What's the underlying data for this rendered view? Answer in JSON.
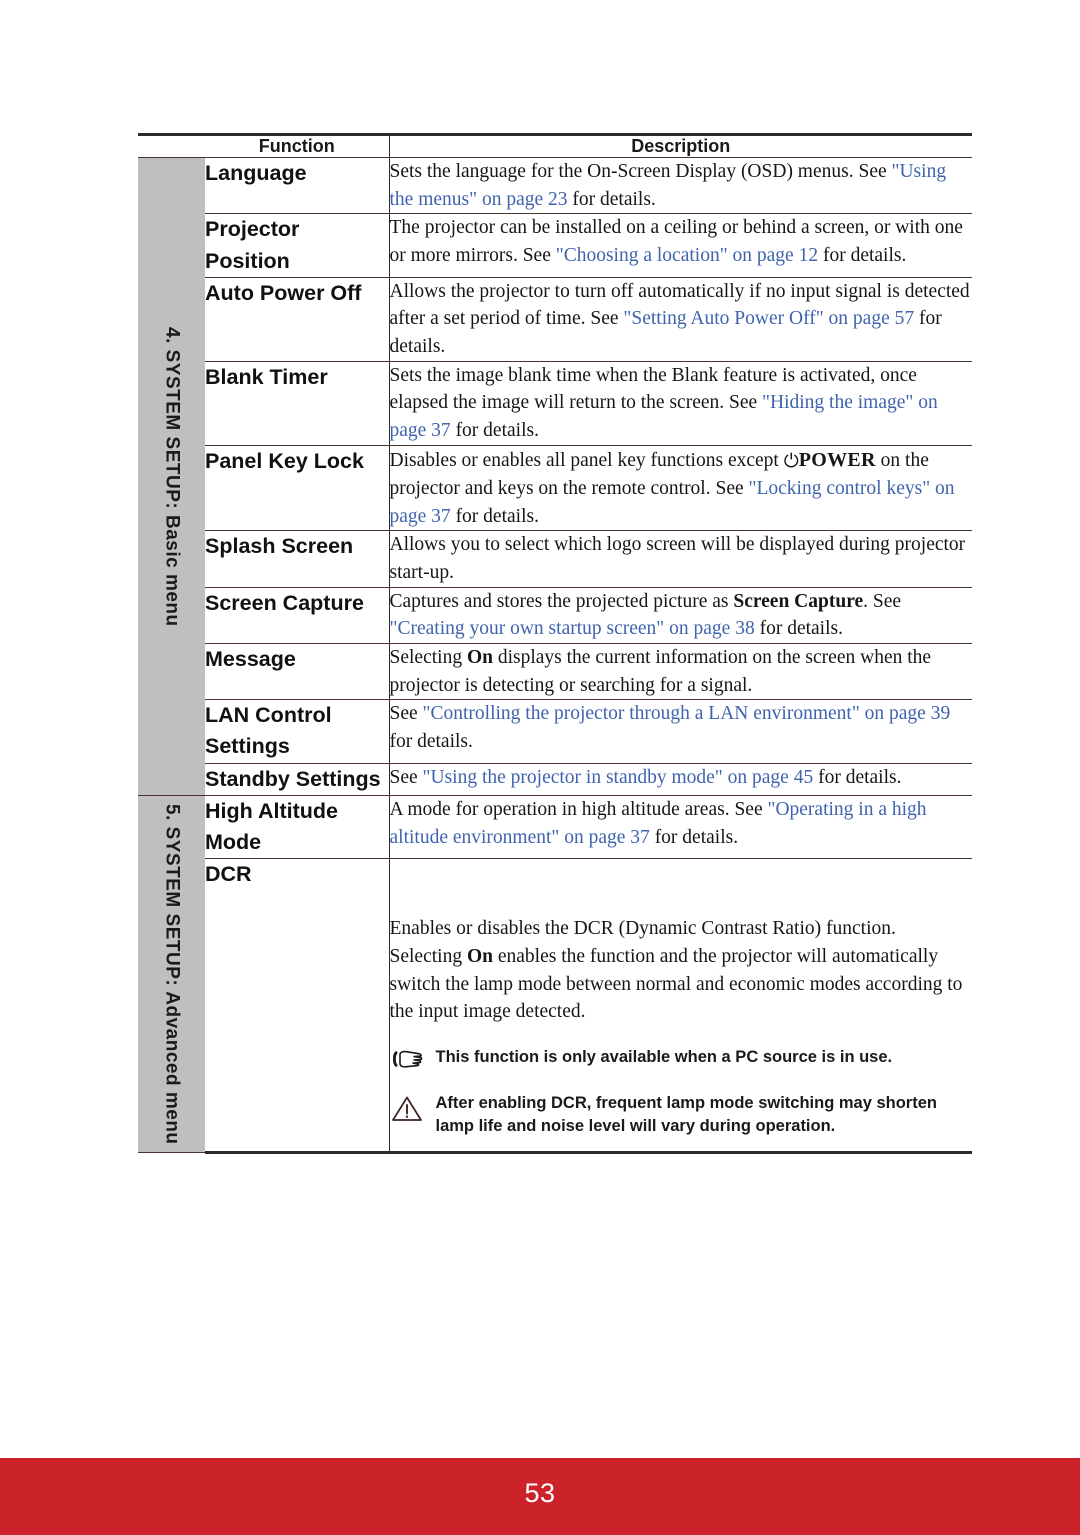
{
  "page": {
    "number": "53",
    "footer_color": "#cc2229",
    "sidebar_color": "#bfbfbf",
    "link_color": "#3f63ad"
  },
  "table": {
    "headers": {
      "function": "Function",
      "description": "Description"
    },
    "sections": [
      {
        "label": "4. SYSTEM SETUP: Basic menu"
      },
      {
        "label": "5. SYSTEM SETUP: Advanced menu"
      }
    ],
    "rows": [
      {
        "function": "Language",
        "desc_parts": [
          {
            "t": "Sets the language for the On-Screen Display (OSD) menus. See ",
            "s": "plain"
          },
          {
            "t": "\"Using the menus\" on page 23",
            "s": "link"
          },
          {
            "t": " for details.",
            "s": "plain"
          }
        ]
      },
      {
        "function": "Projector Position",
        "desc_parts": [
          {
            "t": "The projector can be installed on a ceiling or behind a screen, or with one or more mirrors. See ",
            "s": "plain"
          },
          {
            "t": "\"Choosing a location\" on page 12",
            "s": "link"
          },
          {
            "t": " for details.",
            "s": "plain"
          }
        ]
      },
      {
        "function": "Auto Power Off",
        "desc_parts": [
          {
            "t": "Allows the projector to turn off automatically if no input signal is detected after a set period of time. See ",
            "s": "plain"
          },
          {
            "t": "\"Setting Auto Power Off\" on page 57",
            "s": "link"
          },
          {
            "t": " for details.",
            "s": "plain"
          }
        ]
      },
      {
        "function": "Blank Timer",
        "desc_parts": [
          {
            "t": "Sets the image blank time when the Blank feature is activated, once elapsed the image will return to the screen. See ",
            "s": "plain"
          },
          {
            "t": "\"Hiding the image\" on page 37",
            "s": "link"
          },
          {
            "t": " for details.",
            "s": "plain"
          }
        ]
      },
      {
        "function": "Panel Key Lock",
        "desc_parts": [
          {
            "t": "Disables or enables all panel key functions except ",
            "s": "plain"
          },
          {
            "t": "⏻",
            "s": "power-glyph"
          },
          {
            "t": "POWER",
            "s": "power-word"
          },
          {
            "t": " on the projector and keys on the remote control. See ",
            "s": "plain"
          },
          {
            "t": "\"Locking control keys\" on page 37",
            "s": "link"
          },
          {
            "t": " for details.",
            "s": "plain"
          }
        ]
      },
      {
        "function": "Splash Screen",
        "desc_parts": [
          {
            "t": "Allows you to select which logo screen will be displayed during projector start-up.",
            "s": "plain"
          }
        ]
      },
      {
        "function": "Screen Capture",
        "desc_parts": [
          {
            "t": "Captures and stores the projected picture as ",
            "s": "plain"
          },
          {
            "t": "Screen Capture",
            "s": "bold"
          },
          {
            "t": ". See ",
            "s": "plain"
          },
          {
            "t": "\"Creating your own startup screen\" on page 38",
            "s": "link"
          },
          {
            "t": " for details.",
            "s": "plain"
          }
        ]
      },
      {
        "function": "Message",
        "desc_parts": [
          {
            "t": "Selecting ",
            "s": "plain"
          },
          {
            "t": "On",
            "s": "bold"
          },
          {
            "t": " displays the current information on the screen when the projector is detecting or searching for a signal.",
            "s": "plain"
          }
        ]
      },
      {
        "function": "LAN Control Settings",
        "desc_parts": [
          {
            "t": "See ",
            "s": "plain"
          },
          {
            "t": "\"Controlling the projector through a LAN environment\" on page 39",
            "s": "link"
          },
          {
            "t": " for details.",
            "s": "plain"
          }
        ]
      },
      {
        "function": "Standby Settings",
        "desc_parts": [
          {
            "t": "See ",
            "s": "plain"
          },
          {
            "t": "\"Using the projector in standby mode\" on page 45",
            "s": "link"
          },
          {
            "t": " for details.",
            "s": "plain"
          }
        ]
      },
      {
        "function": "High Altitude Mode",
        "desc_parts": [
          {
            "t": "A mode for operation in high altitude areas. See ",
            "s": "plain"
          },
          {
            "t": "\"Operating in a high altitude environment\" on page 37",
            "s": "link"
          },
          {
            "t": " for details.",
            "s": "plain"
          }
        ]
      },
      {
        "function": "DCR",
        "desc_parts": [
          {
            "t": "Enables or disables the DCR (Dynamic Contrast Ratio) function. Selecting ",
            "s": "plain"
          },
          {
            "t": "On",
            "s": "bold"
          },
          {
            "t": " enables the function and the projector will automatically switch the lamp mode between normal and economic modes according to the input image detected.",
            "s": "plain"
          }
        ],
        "notes": [
          {
            "icon": "pointing-hand-icon",
            "text": "This function is only available when a PC source is in use."
          },
          {
            "icon": "warning-triangle-icon",
            "text": "After enabling DCR, frequent lamp mode switching may shorten lamp life and noise level will vary during operation."
          }
        ]
      }
    ]
  }
}
